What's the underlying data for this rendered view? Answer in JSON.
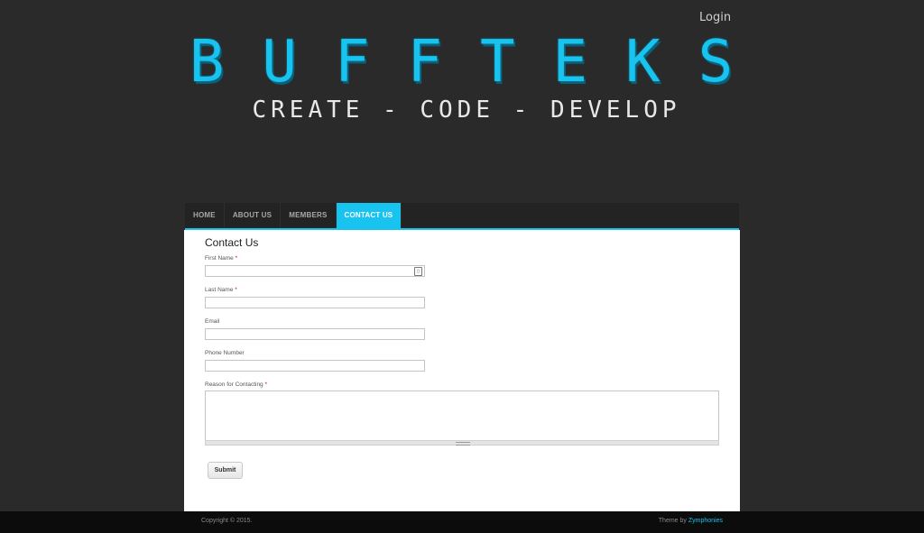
{
  "header": {
    "login_label": "Login",
    "logo_text": "BUFFTEKS",
    "tagline": "CREATE - CODE - DEVELOP"
  },
  "nav": {
    "items": [
      {
        "label": "HOME"
      },
      {
        "label": "ABOUT US"
      },
      {
        "label": "MEMBERS"
      },
      {
        "label": "CONTACT US"
      }
    ],
    "active": "CONTACT US"
  },
  "form": {
    "title": "Contact Us",
    "fields": {
      "first_name": {
        "label": "First Name",
        "required": "*",
        "value": ""
      },
      "last_name": {
        "label": "Last Name",
        "required": "*",
        "value": ""
      },
      "email": {
        "label": "Email",
        "value": ""
      },
      "phone": {
        "label": "Phone Number",
        "value": ""
      },
      "reason": {
        "label": "Reason for Contacting",
        "required": "*",
        "value": ""
      }
    },
    "submit_label": "Submit"
  },
  "footer": {
    "copyright": "Copyright © 2015.",
    "theme_prefix": "Theme by",
    "theme_link": "Zymphonies"
  },
  "colors": {
    "accent": "#19c3f0",
    "background": "#2a2a2a",
    "footer": "#0c0c0c",
    "required": "#dd0000"
  }
}
